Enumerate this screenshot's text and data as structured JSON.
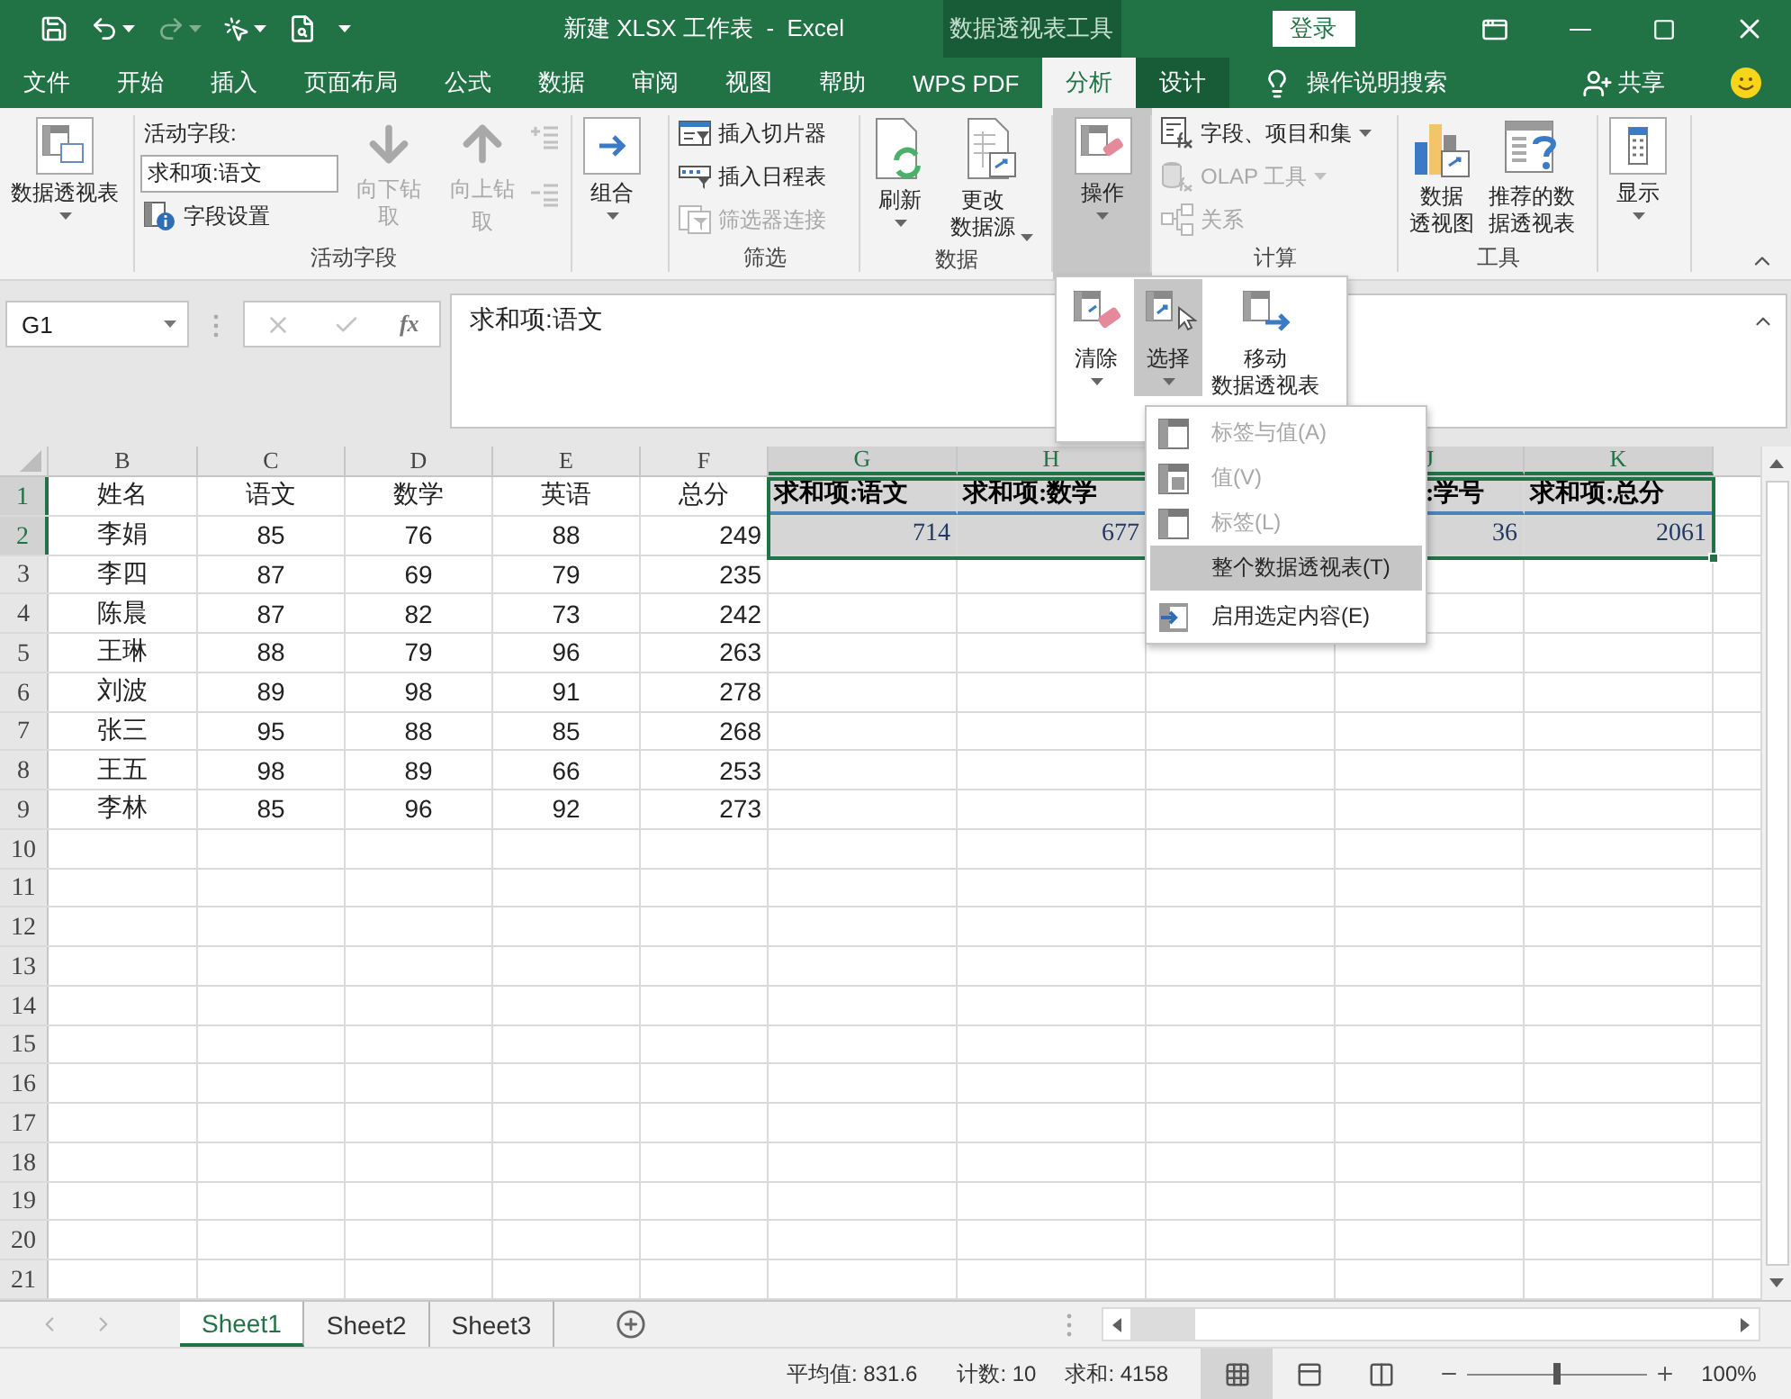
{
  "title_bar": {
    "title": "新建 XLSX 工作表  -  Excel",
    "context_label": "数据透视表工具",
    "sign_in": "登录"
  },
  "tabs": [
    {
      "label": "文件",
      "selected": false,
      "contextual": false
    },
    {
      "label": "开始",
      "selected": false,
      "contextual": false
    },
    {
      "label": "插入",
      "selected": false,
      "contextual": false
    },
    {
      "label": "页面布局",
      "selected": false,
      "contextual": false
    },
    {
      "label": "公式",
      "selected": false,
      "contextual": false
    },
    {
      "label": "数据",
      "selected": false,
      "contextual": false
    },
    {
      "label": "审阅",
      "selected": false,
      "contextual": false
    },
    {
      "label": "视图",
      "selected": false,
      "contextual": false
    },
    {
      "label": "帮助",
      "selected": false,
      "contextual": false
    },
    {
      "label": "WPS PDF",
      "selected": false,
      "contextual": false
    },
    {
      "label": "分析",
      "selected": true,
      "contextual": true
    },
    {
      "label": "设计",
      "selected": false,
      "contextual": true
    }
  ],
  "tell_me": "操作说明搜索",
  "share": "共享",
  "ribbon": {
    "pivot_table": {
      "label": "数据透视表"
    },
    "active_field": {
      "caption": "活动字段:",
      "value": "求和项:语文",
      "settings": "字段设置",
      "drill_down": {
        "label": "向下钻取",
        "disabled": true
      },
      "drill_up": {
        "lines": [
          "向上钻",
          "取"
        ],
        "disabled": true
      },
      "group_label": "活动字段"
    },
    "group_button": {
      "label": "组合"
    },
    "filter": {
      "items": [
        {
          "kind": "slicer",
          "label": "插入切片器",
          "disabled": false
        },
        {
          "kind": "timeline",
          "label": "插入日程表",
          "disabled": false
        },
        {
          "kind": "connections",
          "label": "筛选器连接",
          "disabled": true
        }
      ],
      "group_label": "筛选"
    },
    "data": {
      "refresh": "刷新",
      "change_source": [
        "更改",
        "数据源"
      ],
      "group_label": "数据"
    },
    "actions": {
      "label": "操作",
      "expanded": true
    },
    "calculations": {
      "items": [
        {
          "kind": "fields",
          "label": "字段、项目和集",
          "disabled": false,
          "dropdown": true
        },
        {
          "kind": "olap",
          "label": "OLAP 工具",
          "disabled": true,
          "dropdown": true
        },
        {
          "kind": "relations",
          "label": "关系",
          "disabled": true,
          "dropdown": false
        }
      ],
      "group_label": "计算"
    },
    "tools": {
      "items": [
        {
          "kind": "chart",
          "lines": [
            "数据",
            "透视图"
          ]
        },
        {
          "kind": "recommend",
          "lines": [
            "推荐的数",
            "据透视表"
          ]
        }
      ],
      "group_label": "工具"
    },
    "show": {
      "label": "显示"
    }
  },
  "actions_menu": {
    "buttons": [
      {
        "kind": "clear",
        "label": "清除",
        "selected": false,
        "dropdown": true
      },
      {
        "kind": "select",
        "label": "选择",
        "selected": true,
        "dropdown": true
      },
      {
        "kind": "move",
        "lines": [
          "移动",
          "数据透视表"
        ],
        "selected": false,
        "dropdown": false
      }
    ]
  },
  "select_menu": {
    "items": [
      {
        "kind": "both",
        "label": "标签与值(A)",
        "disabled": true,
        "selected": false
      },
      {
        "kind": "values",
        "label": "值(V)",
        "disabled": true,
        "selected": false
      },
      {
        "kind": "labels",
        "label": "标签(L)",
        "disabled": true,
        "selected": false
      },
      {
        "kind": "whole",
        "label": "整个数据透视表(T)",
        "disabled": false,
        "selected": true
      },
      {
        "kind": "enable",
        "label": "启用选定内容(E)",
        "disabled": false,
        "selected": false
      }
    ]
  },
  "formula_bar": {
    "name_box": "G1",
    "function_label": "fx",
    "formula": "求和项:语文"
  },
  "columns": [
    {
      "label": "B",
      "selected": false
    },
    {
      "label": "C",
      "selected": false
    },
    {
      "label": "D",
      "selected": false
    },
    {
      "label": "E",
      "selected": false
    },
    {
      "label": "F",
      "selected": false
    },
    {
      "label": "G",
      "selected": true
    },
    {
      "label": "H",
      "selected": true
    },
    {
      "label": "J",
      "selected": true
    },
    {
      "label": "K",
      "selected": true
    }
  ],
  "rows": [
    {
      "label": "1",
      "selected": true,
      "cells": [
        "姓名",
        "语文",
        "数学",
        "英语",
        "总分"
      ]
    },
    {
      "label": "2",
      "selected": true,
      "cells": [
        "李娟",
        "85",
        "76",
        "88",
        "249"
      ]
    },
    {
      "label": "3",
      "selected": false,
      "cells": [
        "李四",
        "87",
        "69",
        "79",
        "235"
      ]
    },
    {
      "label": "4",
      "selected": false,
      "cells": [
        "陈晨",
        "87",
        "82",
        "73",
        "242"
      ]
    },
    {
      "label": "5",
      "selected": false,
      "cells": [
        "王琳",
        "88",
        "79",
        "96",
        "263"
      ]
    },
    {
      "label": "6",
      "selected": false,
      "cells": [
        "刘波",
        "89",
        "98",
        "91",
        "278"
      ]
    },
    {
      "label": "7",
      "selected": false,
      "cells": [
        "张三",
        "95",
        "88",
        "85",
        "268"
      ]
    },
    {
      "label": "8",
      "selected": false,
      "cells": [
        "王五",
        "98",
        "89",
        "66",
        "253"
      ]
    },
    {
      "label": "9",
      "selected": false,
      "cells": [
        "李林",
        "85",
        "96",
        "92",
        "273"
      ]
    },
    {
      "label": "10",
      "selected": false
    },
    {
      "label": "11",
      "selected": false
    },
    {
      "label": "12",
      "selected": false
    },
    {
      "label": "13",
      "selected": false
    },
    {
      "label": "14",
      "selected": false
    },
    {
      "label": "15",
      "selected": false
    },
    {
      "label": "16",
      "selected": false
    },
    {
      "label": "17",
      "selected": false
    },
    {
      "label": "18",
      "selected": false
    },
    {
      "label": "19",
      "selected": false
    },
    {
      "label": "20",
      "selected": false
    },
    {
      "label": "21",
      "selected": false
    }
  ],
  "pivot": {
    "headers": [
      {
        "text": "求和项:语文",
        "clipped": false
      },
      {
        "text": "求和项:数学",
        "clipped": false
      },
      {
        "text": ":学号",
        "clipped": true
      },
      {
        "text": "求和项:总分",
        "clipped": false
      }
    ],
    "values": [
      "714",
      "677",
      "36",
      "2061"
    ]
  },
  "sheets": [
    {
      "label": "Sheet1",
      "selected": true
    },
    {
      "label": "Sheet2",
      "selected": false
    },
    {
      "label": "Sheet3",
      "selected": false
    }
  ],
  "status": {
    "average": "平均值: 831.6",
    "count": "计数: 10",
    "sum": "求和: 4158",
    "views": [
      {
        "kind": "normal",
        "selected": true
      },
      {
        "kind": "layout",
        "selected": false
      },
      {
        "kind": "pagebreak",
        "selected": false
      }
    ],
    "zoom": {
      "level": 0.5,
      "reading": "100%"
    }
  }
}
